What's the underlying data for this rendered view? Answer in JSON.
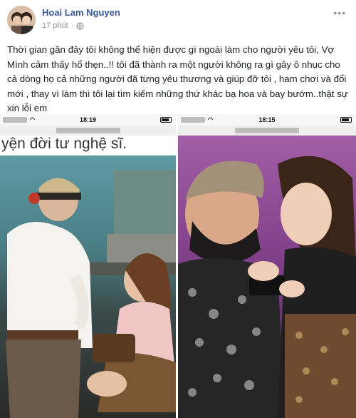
{
  "post": {
    "author": "Hoai Lam Nguyen",
    "time": "17 phút",
    "dot": "·",
    "more_icon": "more-dots-icon",
    "privacy_icon": "globe-icon",
    "text": "Thời gian gần đây tôi không thể hiện được gì ngoài làm cho người yêu tôi, Vợ Mình cảm thấy hổ thẹn..!! tôi đã thành ra một người không ra gì gây ô nhục cho cả dòng họ cả những người đã từng yêu thương và giúp đỡ tôi , ham chơi và đổi mới , thay vì làm thì tôi lại tìm kiếm những thứ khác bạ hoa và bay bướm..thật sự xin lỗi em"
  },
  "photos": {
    "left": {
      "status_time": "18:19",
      "caption": "yện đời tư nghệ sĩ."
    },
    "right": {
      "status_time": "18:15"
    }
  },
  "colors": {
    "author_link": "#385898",
    "meta": "#90949c",
    "text": "#1c1e21"
  }
}
